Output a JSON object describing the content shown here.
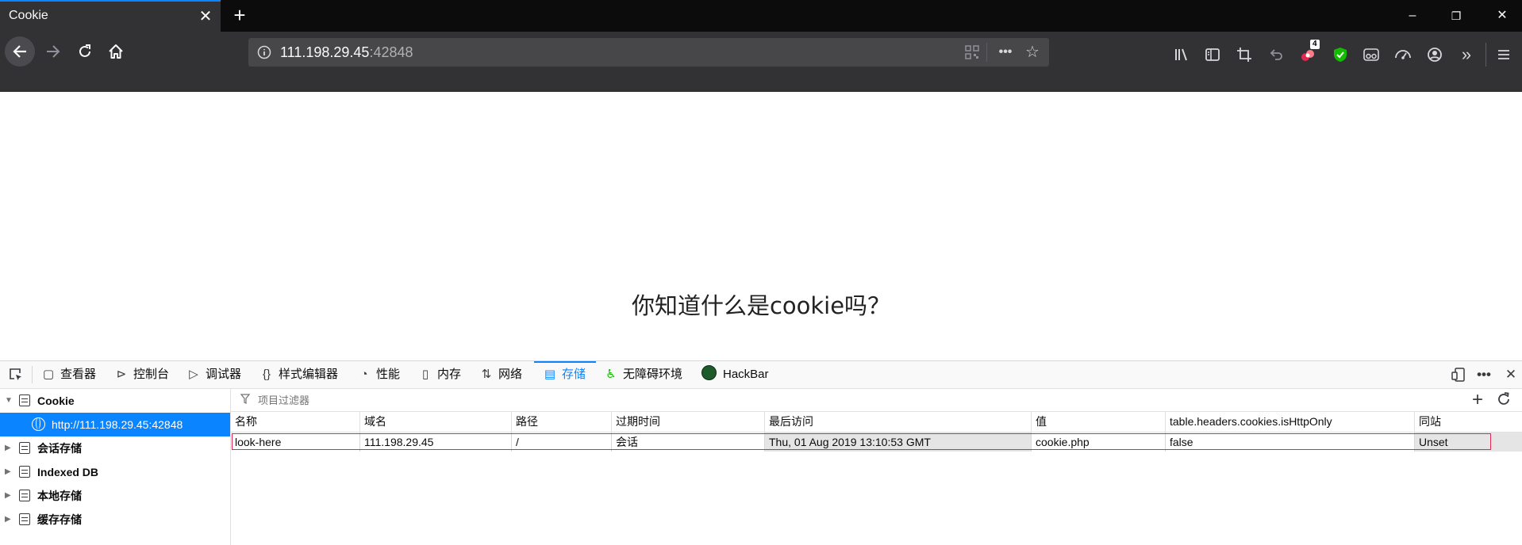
{
  "browser": {
    "tab": {
      "title": "Cookie",
      "close_glyph": "✕"
    },
    "new_tab_glyph": "+",
    "window_controls": {
      "minimize": "–",
      "restore": "❐",
      "close": "✕"
    },
    "badge_count": "4"
  },
  "urlbar": {
    "host": "111.198.29.45",
    "port": ":42848"
  },
  "page": {
    "headline": "你知道什么是cookie吗？"
  },
  "devtools": {
    "tabs": [
      {
        "label": "查看器",
        "icon": "inspector-icon"
      },
      {
        "label": "控制台",
        "icon": "console-icon"
      },
      {
        "label": "调试器",
        "icon": "debugger-icon"
      },
      {
        "label": "样式编辑器",
        "icon": "style-editor-icon"
      },
      {
        "label": "性能",
        "icon": "performance-icon"
      },
      {
        "label": "内存",
        "icon": "memory-icon"
      },
      {
        "label": "网络",
        "icon": "network-icon"
      },
      {
        "label": "存储",
        "icon": "storage-icon",
        "active": true
      },
      {
        "label": "无障碍环境",
        "icon": "accessibility-icon"
      },
      {
        "label": "HackBar",
        "icon": "hackbar-icon"
      }
    ],
    "sidebar": {
      "cookie": "Cookie",
      "cookie_host": "http://111.198.29.45:42848",
      "session_storage": "会话存储",
      "indexed_db": "Indexed DB",
      "local_storage": "本地存储",
      "cache_storage": "缓存存储"
    },
    "filter_placeholder": "项目过滤器",
    "table": {
      "headers": [
        "名称",
        "域名",
        "路径",
        "过期时间",
        "最后访问",
        "值",
        "table.headers.cookies.isHttpOnly",
        "同站"
      ],
      "rows": [
        [
          "look-here",
          "111.198.29.45",
          "/",
          "会话",
          "Thu, 01 Aug 2019 13:10:53 GMT",
          "cookie.php",
          "false",
          "Unset"
        ]
      ]
    },
    "colors": {
      "accent": "#0a84ff",
      "selection_border": "#e22850"
    }
  }
}
